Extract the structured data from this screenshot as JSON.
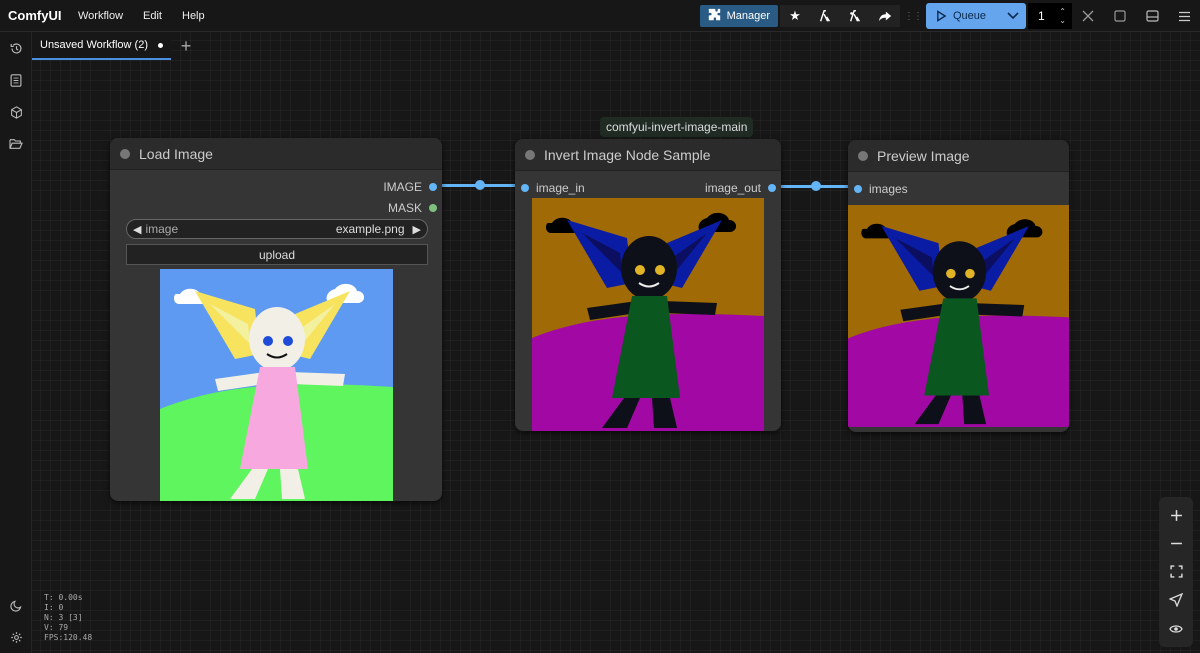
{
  "app": {
    "brand": "ComfyUI"
  },
  "menu": [
    "Workflow",
    "Edit",
    "Help"
  ],
  "toolbar": {
    "manager_label": "Manager",
    "queue_label": "Queue",
    "queue_count": "1"
  },
  "tabs": [
    {
      "label": "Unsaved Workflow (2)",
      "modified": true
    }
  ],
  "group_title": "comfyui-invert-image-main",
  "nodes": {
    "load_image": {
      "title": "Load Image",
      "outputs": [
        "IMAGE",
        "MASK"
      ],
      "combo_label": "image",
      "combo_value": "example.png",
      "upload_label": "upload"
    },
    "invert": {
      "title": "Invert Image Node Sample",
      "input": "image_in",
      "output": "image_out"
    },
    "preview": {
      "title": "Preview Image",
      "input": "images"
    }
  },
  "stats": [
    "T: 0.00s",
    "I: 0",
    "N: 3 [3]",
    "V: 79",
    "FPS:120.48"
  ],
  "colors": {
    "accent": "#64a5ee",
    "manager": "#295b85",
    "wire_image": "#64b5f6",
    "slot_mask": "#7ec07e"
  }
}
